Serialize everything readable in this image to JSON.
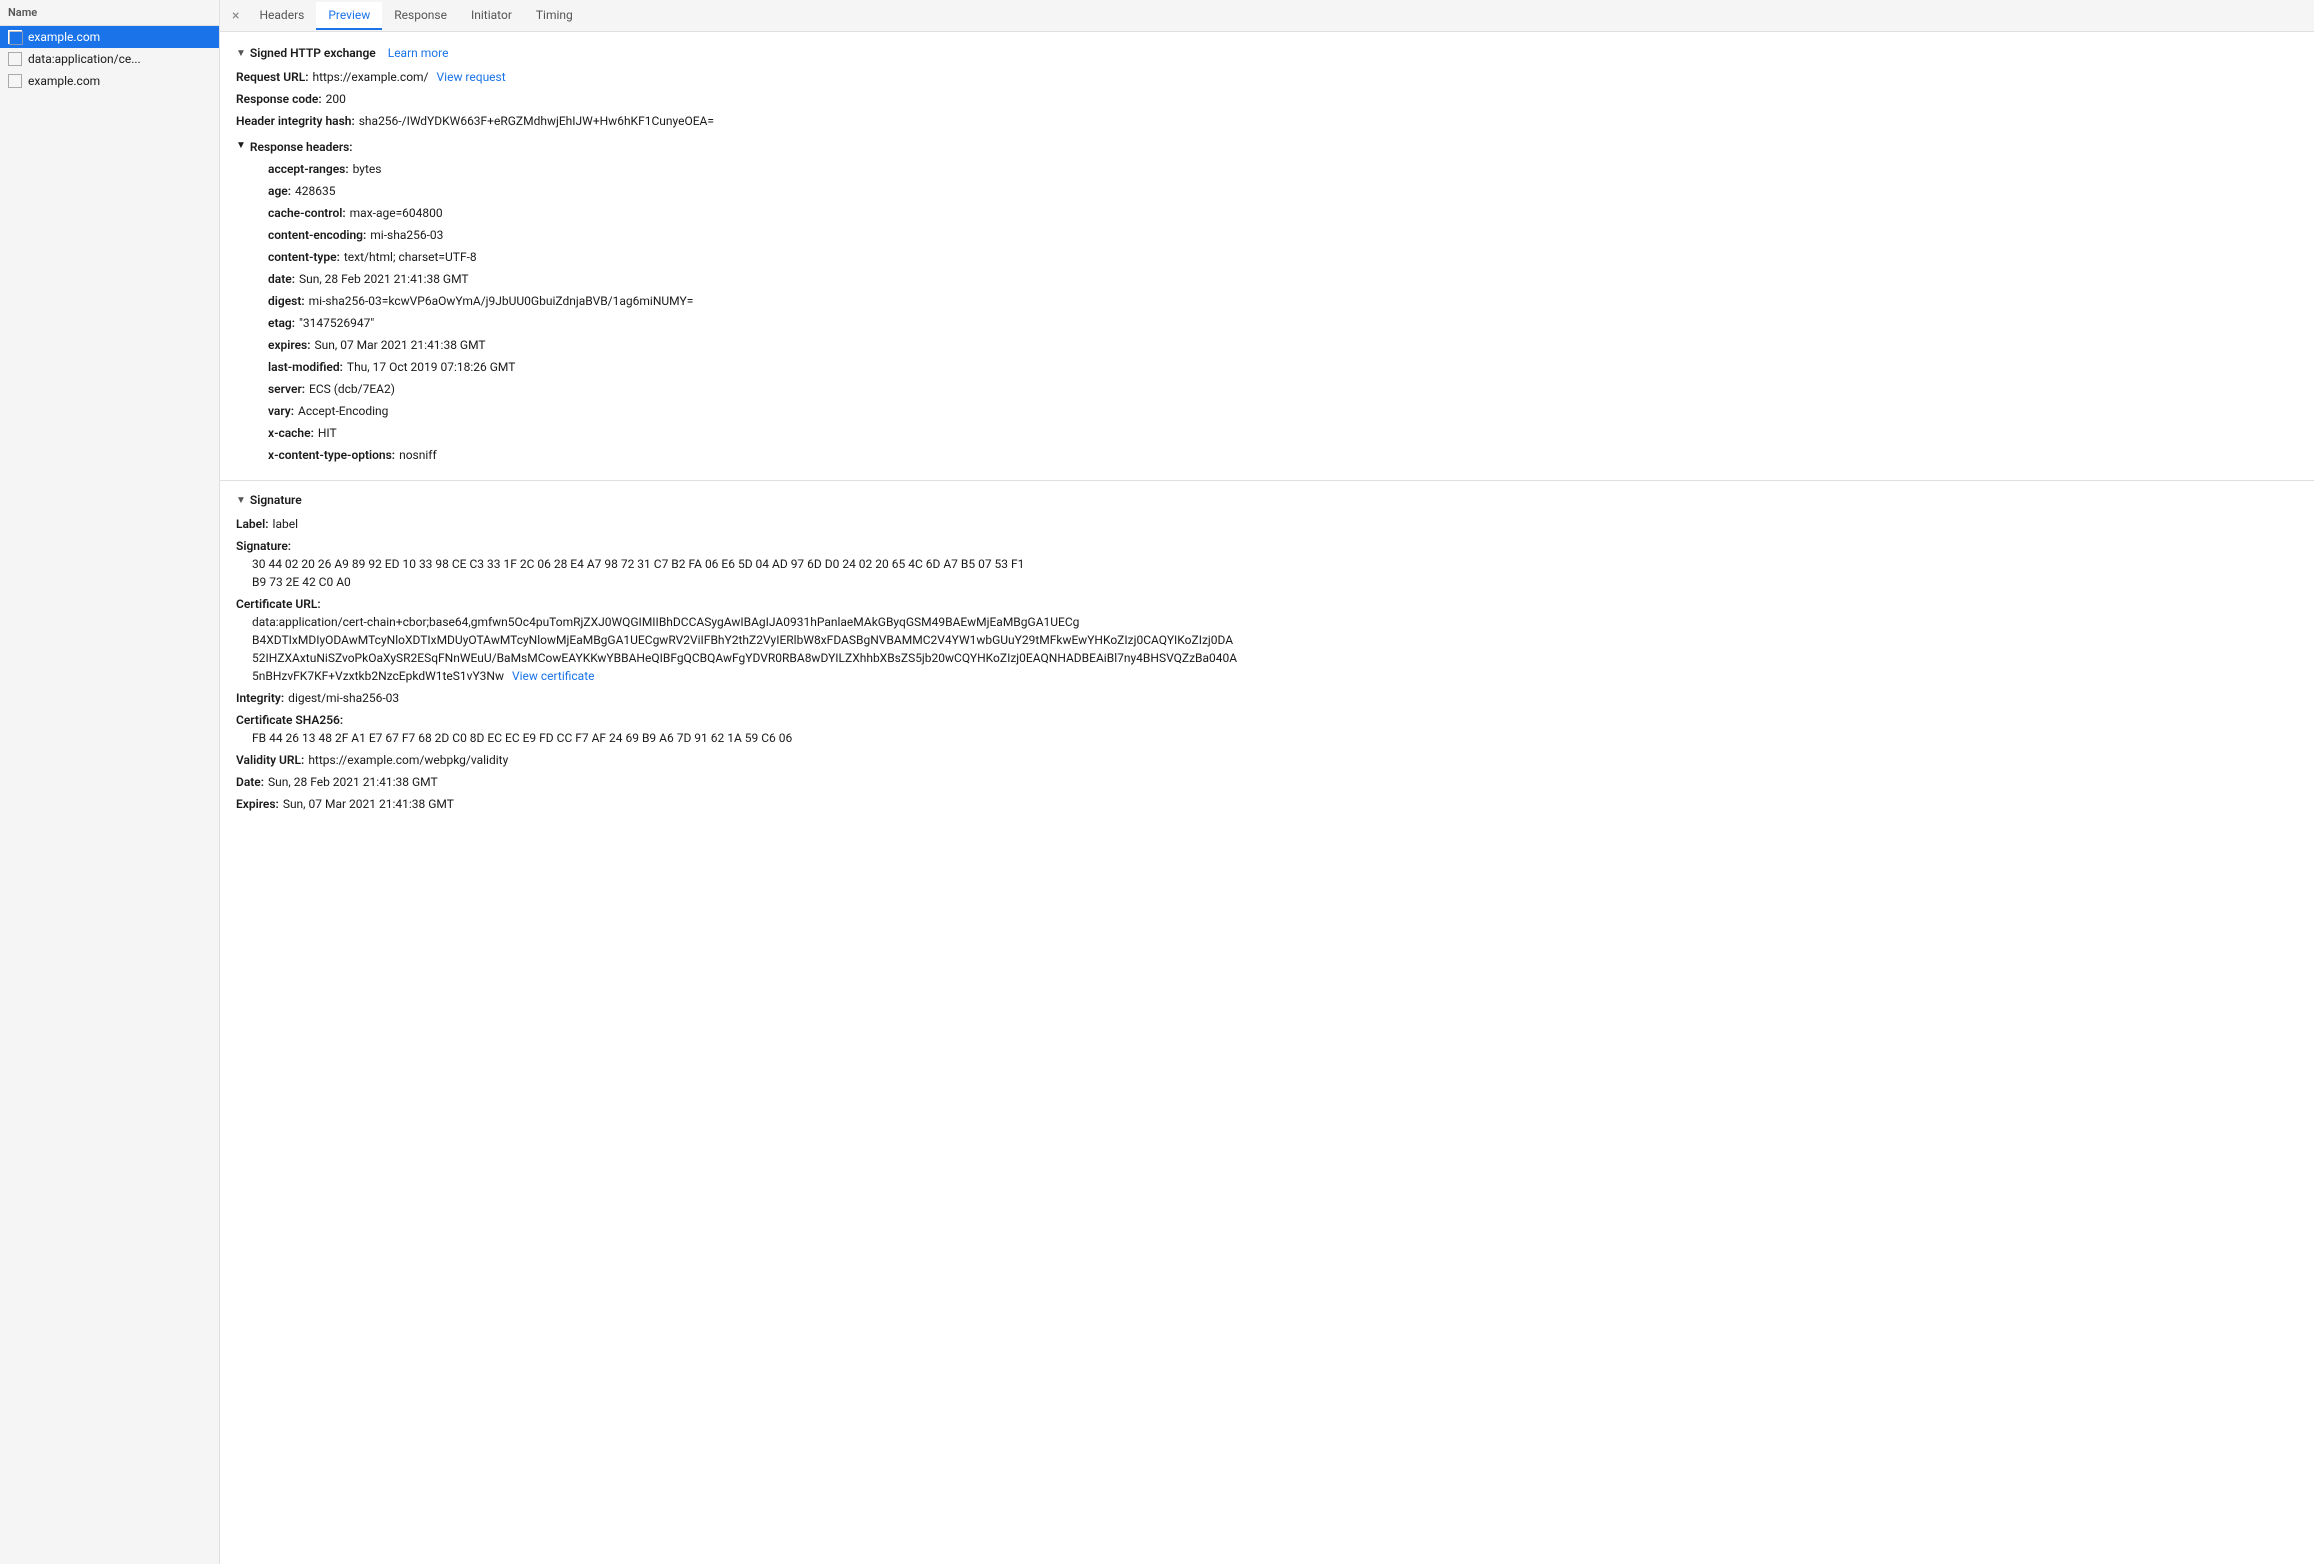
{
  "sidebar": {
    "header": "Name",
    "items": [
      {
        "label": "example.com",
        "active": true
      },
      {
        "label": "data:application/ce...",
        "active": false
      },
      {
        "label": "example.com",
        "active": false
      }
    ]
  },
  "tabs": {
    "close_symbol": "×",
    "items": [
      {
        "label": "Headers",
        "active": false
      },
      {
        "label": "Preview",
        "active": true
      },
      {
        "label": "Response",
        "active": false
      },
      {
        "label": "Initiator",
        "active": false
      },
      {
        "label": "Timing",
        "active": false
      }
    ]
  },
  "signed_http_exchange": {
    "section_label": "Signed HTTP exchange",
    "learn_more": "Learn more",
    "triangle": "▼",
    "request_url_label": "Request URL:",
    "request_url_value": "https://example.com/",
    "view_request_label": "View request",
    "response_code_label": "Response code:",
    "response_code_value": "200",
    "header_integrity_label": "Header integrity hash:",
    "header_integrity_value": "sha256-/IWdYDKW663F+eRGZMdhwjEhIJW+Hw6hKF1CunyeOEA=",
    "response_headers_label": "Response headers:",
    "response_headers_triangle": "▼",
    "headers": [
      {
        "label": "accept-ranges:",
        "value": "bytes"
      },
      {
        "label": "age:",
        "value": "428635"
      },
      {
        "label": "cache-control:",
        "value": "max-age=604800"
      },
      {
        "label": "content-encoding:",
        "value": "mi-sha256-03"
      },
      {
        "label": "content-type:",
        "value": "text/html; charset=UTF-8"
      },
      {
        "label": "date:",
        "value": "Sun, 28 Feb 2021 21:41:38 GMT"
      },
      {
        "label": "digest:",
        "value": "mi-sha256-03=kcwVP6aOwYmA/j9JbUU0GbuiZdnjaBVB/1ag6miNUMY="
      },
      {
        "label": "etag:",
        "value": "\"3147526947\""
      },
      {
        "label": "expires:",
        "value": "Sun, 07 Mar 2021 21:41:38 GMT"
      },
      {
        "label": "last-modified:",
        "value": "Thu, 17 Oct 2019 07:18:26 GMT"
      },
      {
        "label": "server:",
        "value": "ECS (dcb/7EA2)"
      },
      {
        "label": "vary:",
        "value": "Accept-Encoding"
      },
      {
        "label": "x-cache:",
        "value": "HIT"
      },
      {
        "label": "x-content-type-options:",
        "value": "nosniff"
      }
    ]
  },
  "signature": {
    "section_label": "Signature",
    "triangle": "▼",
    "label_key": "Label:",
    "label_value": "label",
    "signature_key": "Signature:",
    "signature_line1": "30 44 02 20 26 A9 89 92 ED 10 33 98 CE C3 33 1F 2C 06 28 E4 A7 98 72 31 C7 B2 FA 06 E6 5D 04 AD 97 6D D0 24 02 20 65 4C 6D A7 B5 07 53 F1",
    "signature_line2": "B9 73 2E 42 C0 A0",
    "cert_url_key": "Certificate URL:",
    "cert_url_line1": "data:application/cert-chain+cbor;base64,gmfwn5Oc4puTomRjZXJ0WQGIMIIBhDCCASygAwIBAgIJA0931hPanlaeMAkGByqGSM49BAEwMjEaMBgGA1UECg",
    "cert_url_line2": "B4XDTIxMDIyODAwMTcyNloXDTIxMDUyOTAwMTcyNlowMjEaMBgGA1UECgwRV2ViIFBhY2thZ2VyIERlbW8xFDASBgNVBAMMC2V4YW1wbGUuY29tMFkwEwYHKoZIzj0CAQYIKoZIzj0DA",
    "cert_url_line3": "52IHZXAxtuNiSZvoPkOaXySR2ESqFNnWEuU/BaMsMCowEAYKKwYBBAHeQIBFgQCBQAwFgYDVR0RBA8wDYILZXhhbXBsZS5jb20wCQYHKoZIzj0EAQNHADBEAiBl7ny4BHSVQZzBa040A",
    "cert_url_line4": "5nBHzvFK7KF+Vzxtkb2NzcEpkdW1teS1vY3Nw",
    "view_certificate_label": "View certificate",
    "integrity_key": "Integrity:",
    "integrity_value": "digest/mi-sha256-03",
    "cert_sha256_key": "Certificate SHA256:",
    "cert_sha256_value": "FB 44 26 13 48 2F A1 E7 67 F7 68 2D C0 8D EC EC E9 FD CC F7 AF 24 69 B9 A6 7D 91 62 1A 59 C6 06",
    "validity_url_key": "Validity URL:",
    "validity_url_value": "https://example.com/webpkg/validity",
    "date_key": "Date:",
    "date_value": "Sun, 28 Feb 2021 21:41:38 GMT",
    "expires_key": "Expires:",
    "expires_value": "Sun, 07 Mar 2021 21:41:38 GMT"
  }
}
